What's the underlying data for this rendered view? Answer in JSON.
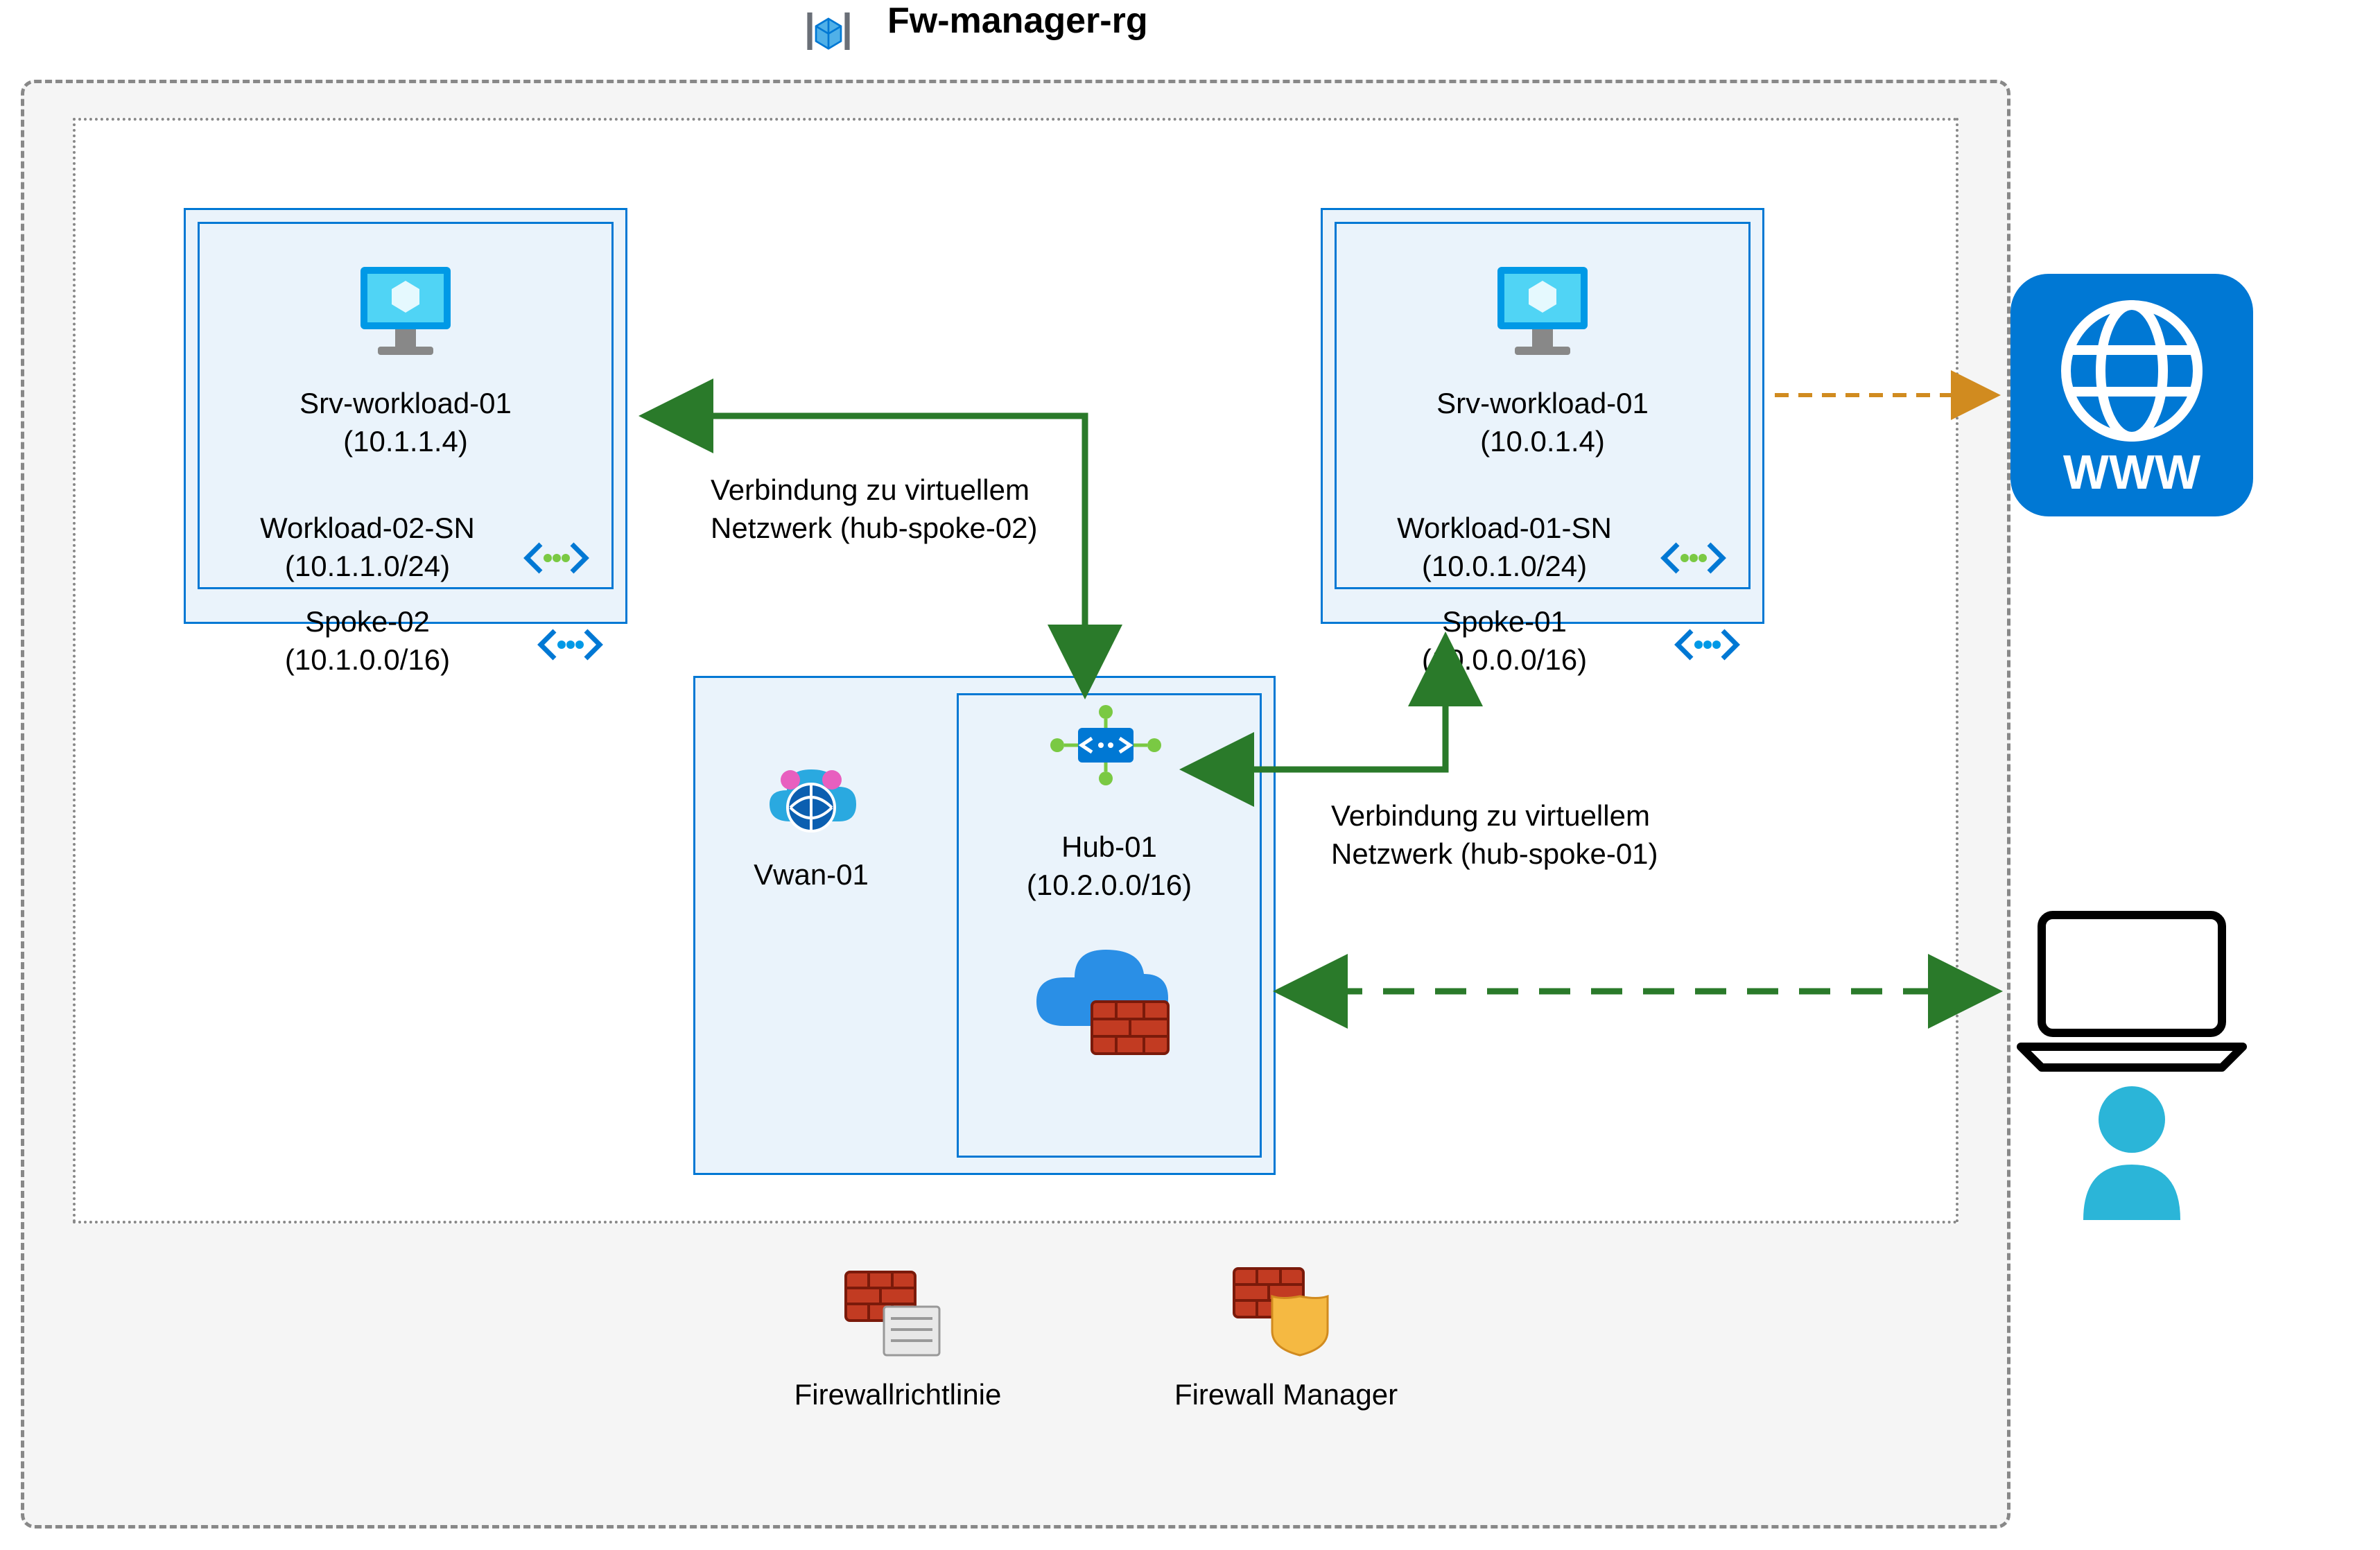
{
  "title": "Fw-manager-rg",
  "spoke02": {
    "vm_name": "Srv-workload-01",
    "vm_ip": "(10.1.1.4)",
    "subnet_name": "Workload-02-SN",
    "subnet_cidr": "(10.1.1.0/24)",
    "vnet_name": "Spoke-02",
    "vnet_cidr": "(10.1.0.0/16)"
  },
  "spoke01": {
    "vm_name": "Srv-workload-01",
    "vm_ip": "(10.0.1.4)",
    "subnet_name": "Workload-01-SN",
    "subnet_cidr": "(10.0.1.0/24)",
    "vnet_name": "Spoke-01",
    "vnet_cidr": "(10.0.0.0/16)"
  },
  "vwan": {
    "name": "Vwan-01"
  },
  "hub": {
    "name": "Hub-01",
    "cidr": "(10.2.0.0/16)"
  },
  "conn02": {
    "line1": "Verbindung zu virtuellem",
    "line2": "Netzwerk (hub-spoke-02)"
  },
  "conn01": {
    "line1": "Verbindung zu virtuellem",
    "line2": "Netzwerk (hub-spoke-01)"
  },
  "legend": {
    "firewall_policy": "Firewallrichtlinie",
    "firewall_manager": "Firewall Manager"
  },
  "www_label": "WWW"
}
